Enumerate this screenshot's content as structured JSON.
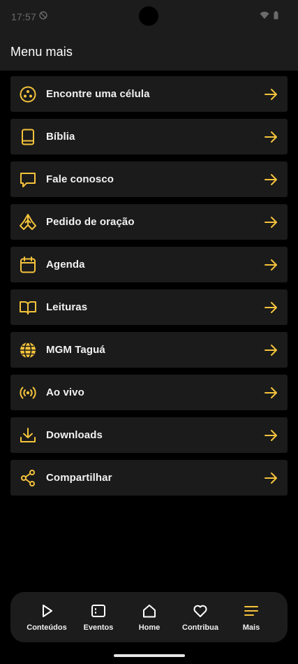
{
  "status_bar": {
    "time": "17:57"
  },
  "header": {
    "title": "Menu mais"
  },
  "menu": {
    "items": [
      {
        "label": "Encontre uma célula",
        "icon": "cell-group-icon"
      },
      {
        "label": "Bíblia",
        "icon": "bible-icon"
      },
      {
        "label": "Fale conosco",
        "icon": "chat-icon"
      },
      {
        "label": "Pedido de oração",
        "icon": "praying-hands-icon"
      },
      {
        "label": "Agenda",
        "icon": "calendar-icon"
      },
      {
        "label": "Leituras",
        "icon": "open-book-icon"
      },
      {
        "label": "MGM Taguá",
        "icon": "globe-icon"
      },
      {
        "label": "Ao vivo",
        "icon": "broadcast-icon"
      },
      {
        "label": "Downloads",
        "icon": "download-icon"
      },
      {
        "label": "Compartilhar",
        "icon": "share-icon"
      }
    ]
  },
  "bottom_nav": {
    "items": [
      {
        "label": "Conteúdos",
        "icon": "play-icon"
      },
      {
        "label": "Eventos",
        "icon": "events-icon"
      },
      {
        "label": "Home",
        "icon": "home-icon"
      },
      {
        "label": "Contribua",
        "icon": "heart-icon"
      },
      {
        "label": "Mais",
        "icon": "menu-icon",
        "active": true
      }
    ]
  },
  "colors": {
    "accent": "#f5c33b",
    "background": "#000000",
    "card": "#1b1b1b",
    "header": "#1c1c1c"
  }
}
